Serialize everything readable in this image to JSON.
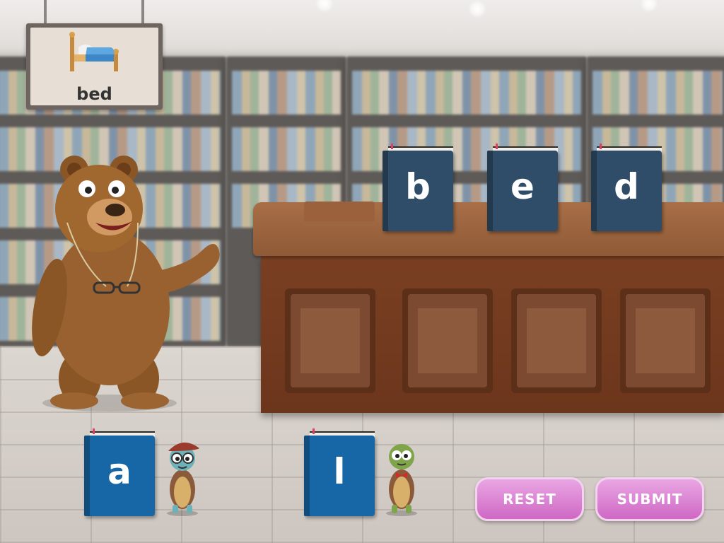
{
  "sign": {
    "word": "bed",
    "icon": "bed-icon"
  },
  "slots": [
    {
      "letter": "b"
    },
    {
      "letter": "e"
    },
    {
      "letter": "d"
    }
  ],
  "tray": [
    {
      "letter": "a",
      "helper": "girl-turtle"
    },
    {
      "letter": "l",
      "helper": "boy-turtle"
    }
  ],
  "buttons": {
    "reset": "RESET",
    "submit": "SUBMIT"
  },
  "colors": {
    "desk_book": "#2f4d68",
    "floor_book": "#1767a6",
    "button": "#d97ad0",
    "desk": "#8f5a37"
  }
}
